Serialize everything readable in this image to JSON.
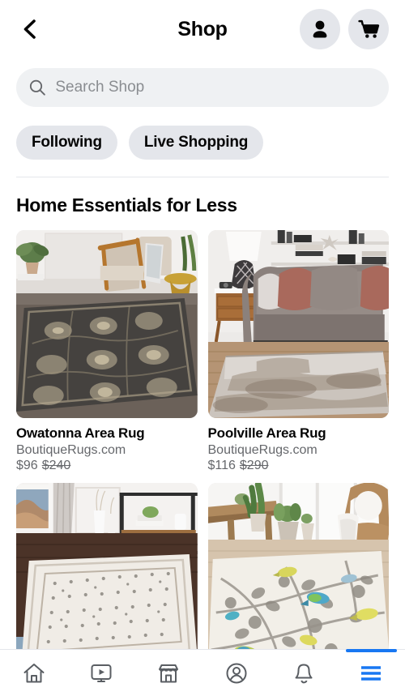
{
  "header": {
    "back_icon": "chevron-left-icon",
    "title": "Shop",
    "profile_icon": "person-icon",
    "cart_icon": "shopping-cart-icon"
  },
  "search": {
    "icon": "search-icon",
    "placeholder": "Search Shop",
    "value": ""
  },
  "chips": [
    {
      "label": "Following"
    },
    {
      "label": "Live Shopping"
    }
  ],
  "section": {
    "title": "Home Essentials for Less"
  },
  "products": [
    {
      "title": "Owatonna Area Rug",
      "merchant": "BoutiqueRugs.com",
      "price": "$96",
      "original_price": "$240",
      "image": "dark-charcoal-ornate-rug-living-room"
    },
    {
      "title": "Poolville Area Rug",
      "merchant": "BoutiqueRugs.com",
      "price": "$116",
      "original_price": "$290",
      "image": "abstract-gray-rug-with-sofa"
    },
    {
      "title": "",
      "merchant": "",
      "price": "",
      "original_price": "",
      "image": "cream-diamond-pattern-rug-entryway"
    },
    {
      "title": "",
      "merchant": "",
      "price": "",
      "original_price": "",
      "image": "cream-floral-bird-rug-with-rattan-chair"
    }
  ],
  "bottom_nav": {
    "items": [
      {
        "icon": "home-icon",
        "active": false
      },
      {
        "icon": "watch-video-icon",
        "active": false
      },
      {
        "icon": "marketplace-store-icon",
        "active": false
      },
      {
        "icon": "profile-circle-icon",
        "active": false
      },
      {
        "icon": "bell-notifications-icon",
        "active": false
      },
      {
        "icon": "hamburger-menu-icon",
        "active": true
      }
    ],
    "active_color": "#1877F2",
    "inactive_color": "#5A5E63"
  }
}
